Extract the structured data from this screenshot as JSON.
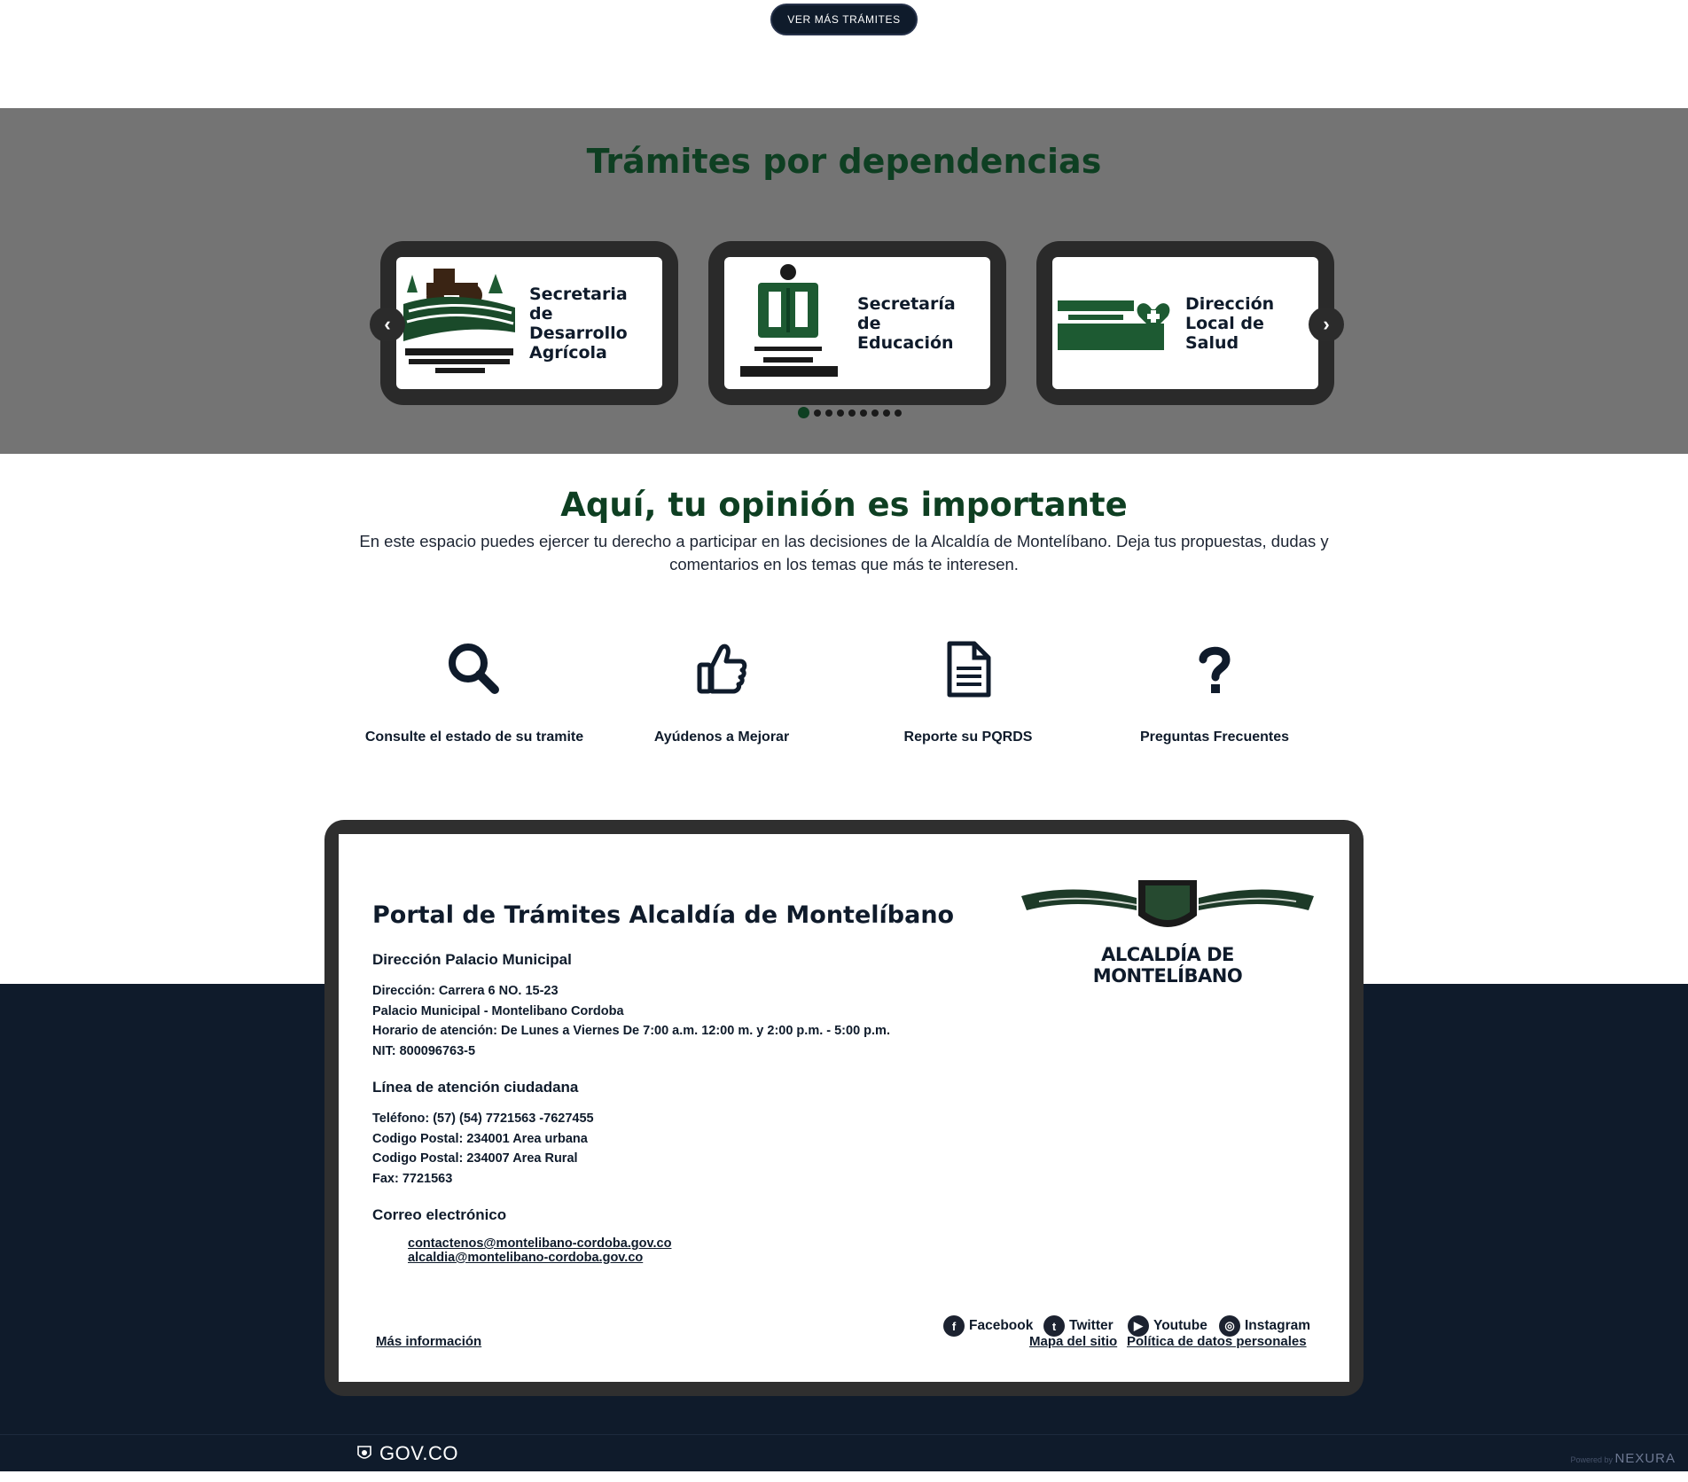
{
  "top": {
    "ver_mas_label": "VER MÁS TRÁMITES"
  },
  "dependencias": {
    "title": "Trámites por dependencias",
    "cards": [
      {
        "label": "Secretaria de Desarrollo Agrícola",
        "logo_icon": "tractor-field-logo-icon"
      },
      {
        "label": "Secretaría de Educación",
        "logo_icon": "book-reader-logo-icon"
      },
      {
        "label": "Dirección Local de Salud",
        "logo_icon": "salud-heart-logo-icon"
      }
    ],
    "prev_icon": "chevron-left-icon",
    "next_icon": "chevron-right-icon",
    "dots_count": 9,
    "active_dot": 1
  },
  "opinion": {
    "title": "Aquí, tu opinión es importante",
    "description": "En este espacio puedes ejercer tu derecho a participar en las decisiones de la Alcaldía de Montelíbano. Deja tus propuestas, dudas y comentarios en los temas que más te interesen.",
    "items": [
      {
        "label": "Consulte el estado de su tramite",
        "icon": "search-icon"
      },
      {
        "label": "Ayúdenos a Mejorar",
        "icon": "thumbs-up-icon"
      },
      {
        "label": "Reporte su PQRDS",
        "icon": "document-icon"
      },
      {
        "label": "Preguntas Frecuentes",
        "icon": "question-icon"
      }
    ]
  },
  "footer": {
    "portal_title": "Portal de Trámites Alcaldía de Montelíbano",
    "logo_text": "ALCALDÍA DE MONTELÍBANO",
    "direccion_heading": "Dirección Palacio Municipal",
    "direccion_lines": [
      "Dirección: Carrera 6 NO. 15-23",
      "Palacio Municipal - Montelibano Cordoba",
      "Horario de atención: De Lunes a Viernes De 7:00 a.m. 12:00 m. y 2:00 p.m. - 5:00 p.m.",
      "NIT: 800096763-5"
    ],
    "linea_heading": "Línea de atención ciudadana",
    "linea_lines": [
      "Teléfono: (57) (54) 7721563 -7627455",
      "Codigo Postal: 234001 Area urbana",
      "Codigo Postal: 234007 Area Rural",
      "Fax: 7721563"
    ],
    "correo_heading": "Correo electrónico",
    "emails": [
      "contactenos@montelibano-cordoba.gov.co",
      "alcaldia@montelibano-cordoba.gov.co"
    ],
    "social": [
      {
        "label": "Facebook",
        "icon": "facebook-icon"
      },
      {
        "label": "Twitter",
        "icon": "twitter-icon"
      },
      {
        "label": "Youtube",
        "icon": "youtube-icon"
      },
      {
        "label": "Instagram",
        "icon": "instagram-icon"
      }
    ],
    "mas_info": "Más información",
    "mapa": "Mapa del sitio",
    "politica": "Política de datos personales"
  },
  "gov": {
    "label": "GOV.CO",
    "powered_by": "Powered by",
    "nexura": "NEXURA"
  }
}
